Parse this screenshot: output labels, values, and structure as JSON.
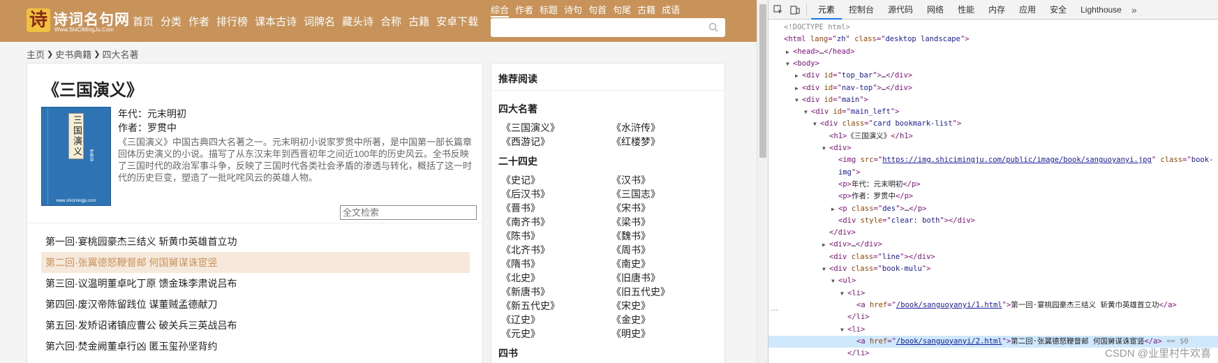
{
  "site": {
    "logo": {
      "name": "诗词名句网",
      "url": "Www.ShiCiMingJu.Com"
    },
    "nav": [
      "首页",
      "分类",
      "作者",
      "排行榜",
      "课本古诗",
      "词牌名",
      "藏头诗",
      "合称",
      "古籍",
      "安卓下载"
    ],
    "search_tabs": [
      "综合",
      "作者",
      "标题",
      "诗句",
      "句首",
      "句尾",
      "古籍",
      "成语"
    ],
    "search_active": "综合",
    "search_placeholder": "",
    "breadcrumb": [
      "主页",
      "史书典籍",
      "四大名著"
    ],
    "book": {
      "title": "《三国演义》",
      "cover_text": "三国演义",
      "cover_sub": "罗贯中",
      "cover_url": "www.shicimingju.com",
      "era": "年代：元末明初",
      "author": "作者：罗贯中",
      "description": "《三国演义》中国古典四大名著之一。元末明初小说家罗贯中所著，是中国第一部长篇章回体历史演义的小说。描写了从东汉末年到西晋初年之间近100年的历史风云。全书反映了三国时代的政治军事斗争，反映了三国时代各类社会矛盾的渗透与转化，概括了这一时代的历史巨变，塑造了一批叱咤风云的英雄人物。"
    },
    "fulltext_placeholder": "全文检索",
    "chapters": [
      "第一回·宴桃园豪杰三结义 斩黄巾英雄首立功",
      "第二回·张翼德怒鞭督邮 何国舅谋诛宦竖",
      "第三回·议温明董卓叱丁原 馈金珠李肃说吕布",
      "第四回·废汉帝陈留践位 谋董贼孟德献刀",
      "第五回·发矫诏诸镇应曹公 破关兵三英战吕布",
      "第六回·焚金阙董卓行凶 匿玉玺孙坚背约"
    ],
    "highlighted_chapter": 1,
    "sidebar": {
      "heading": "推荐阅读",
      "sections": [
        {
          "title": "四大名著",
          "items": [
            "《三国演义》",
            "《水浒传》",
            "《西游记》",
            "《红楼梦》"
          ]
        },
        {
          "title": "二十四史",
          "items": [
            "《史记》",
            "《汉书》",
            "《后汉书》",
            "《三国志》",
            "《晋书》",
            "《宋书》",
            "《南齐书》",
            "《梁书》",
            "《陈书》",
            "《魏书》",
            "《北齐书》",
            "《周书》",
            "《隋书》",
            "《南史》",
            "《北史》",
            "《旧唐书》",
            "《新唐书》",
            "《旧五代史》",
            "《新五代史》",
            "《宋史》",
            "《辽史》",
            "《金史》",
            "《元史》",
            "《明史》"
          ]
        },
        {
          "title": "四书",
          "items": []
        }
      ]
    }
  },
  "devtools": {
    "tabs": [
      "元素",
      "控制台",
      "源代码",
      "网络",
      "性能",
      "内存",
      "应用",
      "安全",
      "Lighthouse"
    ],
    "active_tab": "元素",
    "more": "»",
    "lines": [
      {
        "indent": 0,
        "tri": "",
        "parts": [
          [
            "dim",
            "<!DOCTYPE html>"
          ]
        ]
      },
      {
        "indent": 0,
        "tri": "",
        "parts": [
          [
            "t",
            "<html "
          ],
          [
            "an",
            "lang"
          ],
          [
            "t",
            "=\""
          ],
          [
            "av",
            "zh"
          ],
          [
            "t",
            "\" "
          ],
          [
            "an",
            "class"
          ],
          [
            "t",
            "=\""
          ],
          [
            "av",
            "desktop landscape"
          ],
          [
            "t",
            "\">"
          ]
        ]
      },
      {
        "indent": 1,
        "tri": "▶",
        "parts": [
          [
            "t",
            "<head>"
          ],
          [
            "tx",
            "…"
          ],
          [
            "t",
            "</head>"
          ]
        ]
      },
      {
        "indent": 1,
        "tri": "▼",
        "parts": [
          [
            "t",
            "<body>"
          ]
        ]
      },
      {
        "indent": 2,
        "tri": "▶",
        "parts": [
          [
            "t",
            "<div "
          ],
          [
            "an",
            "id"
          ],
          [
            "t",
            "=\""
          ],
          [
            "av",
            "top_bar"
          ],
          [
            "t",
            "\">"
          ],
          [
            "tx",
            "…"
          ],
          [
            "t",
            "</div>"
          ]
        ]
      },
      {
        "indent": 2,
        "tri": "▶",
        "parts": [
          [
            "t",
            "<div "
          ],
          [
            "an",
            "id"
          ],
          [
            "t",
            "=\""
          ],
          [
            "av",
            "nav-top"
          ],
          [
            "t",
            "\">"
          ],
          [
            "tx",
            "…"
          ],
          [
            "t",
            "</div>"
          ]
        ]
      },
      {
        "indent": 2,
        "tri": "▼",
        "parts": [
          [
            "t",
            "<div "
          ],
          [
            "an",
            "id"
          ],
          [
            "t",
            "=\""
          ],
          [
            "av",
            "main"
          ],
          [
            "t",
            "\">"
          ]
        ]
      },
      {
        "indent": 3,
        "tri": "▼",
        "parts": [
          [
            "t",
            "<div "
          ],
          [
            "an",
            "id"
          ],
          [
            "t",
            "=\""
          ],
          [
            "av",
            "main_left"
          ],
          [
            "t",
            "\">"
          ]
        ]
      },
      {
        "indent": 4,
        "tri": "▼",
        "parts": [
          [
            "t",
            "<div "
          ],
          [
            "an",
            "class"
          ],
          [
            "t",
            "=\""
          ],
          [
            "av",
            "card bookmark-list"
          ],
          [
            "t",
            "\">"
          ]
        ]
      },
      {
        "indent": 5,
        "tri": "",
        "parts": [
          [
            "t",
            "<h1>"
          ],
          [
            "tx",
            "《三国演义》"
          ],
          [
            "t",
            "</h1>"
          ]
        ]
      },
      {
        "indent": 5,
        "tri": "▼",
        "parts": [
          [
            "t",
            "<div>"
          ]
        ]
      },
      {
        "indent": 6,
        "tri": "",
        "parts": [
          [
            "t",
            "<img "
          ],
          [
            "an",
            "src"
          ],
          [
            "t",
            "=\""
          ],
          [
            "lk",
            "https://img.shicimingju.com/public/image/book/sanguoyanyi.jpg"
          ],
          [
            "t",
            "\" "
          ],
          [
            "an",
            "class"
          ],
          [
            "t",
            "=\""
          ],
          [
            "av",
            "book-"
          ]
        ]
      },
      {
        "indent": 6,
        "tri": "",
        "parts": [
          [
            "av",
            "img"
          ],
          [
            "t",
            "\">"
          ]
        ]
      },
      {
        "indent": 6,
        "tri": "",
        "parts": [
          [
            "t",
            "<p>"
          ],
          [
            "tx",
            "年代：元末明初"
          ],
          [
            "t",
            "</p>"
          ]
        ]
      },
      {
        "indent": 6,
        "tri": "",
        "parts": [
          [
            "t",
            "<p>"
          ],
          [
            "tx",
            "作者：罗贯中"
          ],
          [
            "t",
            "</p>"
          ]
        ]
      },
      {
        "indent": 6,
        "tri": "▶",
        "parts": [
          [
            "t",
            "<p "
          ],
          [
            "an",
            "class"
          ],
          [
            "t",
            "=\""
          ],
          [
            "av",
            "des"
          ],
          [
            "t",
            "\">"
          ],
          [
            "tx",
            "…"
          ],
          [
            "t",
            "</p>"
          ]
        ]
      },
      {
        "indent": 6,
        "tri": "",
        "parts": [
          [
            "t",
            "<div "
          ],
          [
            "an",
            "style"
          ],
          [
            "t",
            "=\""
          ],
          [
            "av",
            "clear: both"
          ],
          [
            "t",
            "\">"
          ],
          [
            "t",
            "</div>"
          ]
        ]
      },
      {
        "indent": 5,
        "tri": "",
        "parts": [
          [
            "t",
            "</div>"
          ]
        ]
      },
      {
        "indent": 5,
        "tri": "▶",
        "parts": [
          [
            "t",
            "<div>"
          ],
          [
            "tx",
            "…"
          ],
          [
            "t",
            "</div>"
          ]
        ]
      },
      {
        "indent": 5,
        "tri": "",
        "parts": [
          [
            "t",
            "<div "
          ],
          [
            "an",
            "class"
          ],
          [
            "t",
            "=\""
          ],
          [
            "av",
            "line"
          ],
          [
            "t",
            "\">"
          ],
          [
            "t",
            "</div>"
          ]
        ]
      },
      {
        "indent": 5,
        "tri": "▼",
        "parts": [
          [
            "t",
            "<div "
          ],
          [
            "an",
            "class"
          ],
          [
            "t",
            "=\""
          ],
          [
            "av",
            "book-mulu"
          ],
          [
            "t",
            "\">"
          ]
        ]
      },
      {
        "indent": 6,
        "tri": "▼",
        "parts": [
          [
            "t",
            "<ul>"
          ]
        ]
      },
      {
        "indent": 7,
        "tri": "▼",
        "parts": [
          [
            "t",
            "<li>"
          ]
        ]
      },
      {
        "indent": 8,
        "tri": "",
        "parts": [
          [
            "t",
            "<a "
          ],
          [
            "an",
            "href"
          ],
          [
            "t",
            "=\""
          ],
          [
            "lk",
            "/book/sanguoyanyi/1.html"
          ],
          [
            "t",
            "\">"
          ],
          [
            "tx",
            "第一回·宴桃园豪杰三结义 斩黄巾英雄首立功"
          ],
          [
            "t",
            "</a>"
          ]
        ]
      },
      {
        "indent": 7,
        "tri": "",
        "parts": [
          [
            "t",
            "</li>"
          ]
        ]
      },
      {
        "indent": 7,
        "tri": "▼",
        "parts": [
          [
            "t",
            "<li>"
          ]
        ]
      },
      {
        "indent": 8,
        "tri": "",
        "sel": true,
        "parts": [
          [
            "t",
            "<a "
          ],
          [
            "an",
            "href"
          ],
          [
            "t",
            "=\""
          ],
          [
            "lk",
            "/book/sanguoyanyi/2.html"
          ],
          [
            "t",
            "\">"
          ],
          [
            "tx",
            "第二回·张翼德怒鞭督邮 何国舅谋诛宦竖"
          ],
          [
            "t",
            "</a>"
          ],
          [
            "dim",
            " == $0"
          ]
        ]
      },
      {
        "indent": 7,
        "tri": "",
        "parts": [
          [
            "t",
            "</li>"
          ]
        ]
      }
    ],
    "selected_marker": "…",
    "watermark": "CSDN @业里村牛欢喜"
  }
}
